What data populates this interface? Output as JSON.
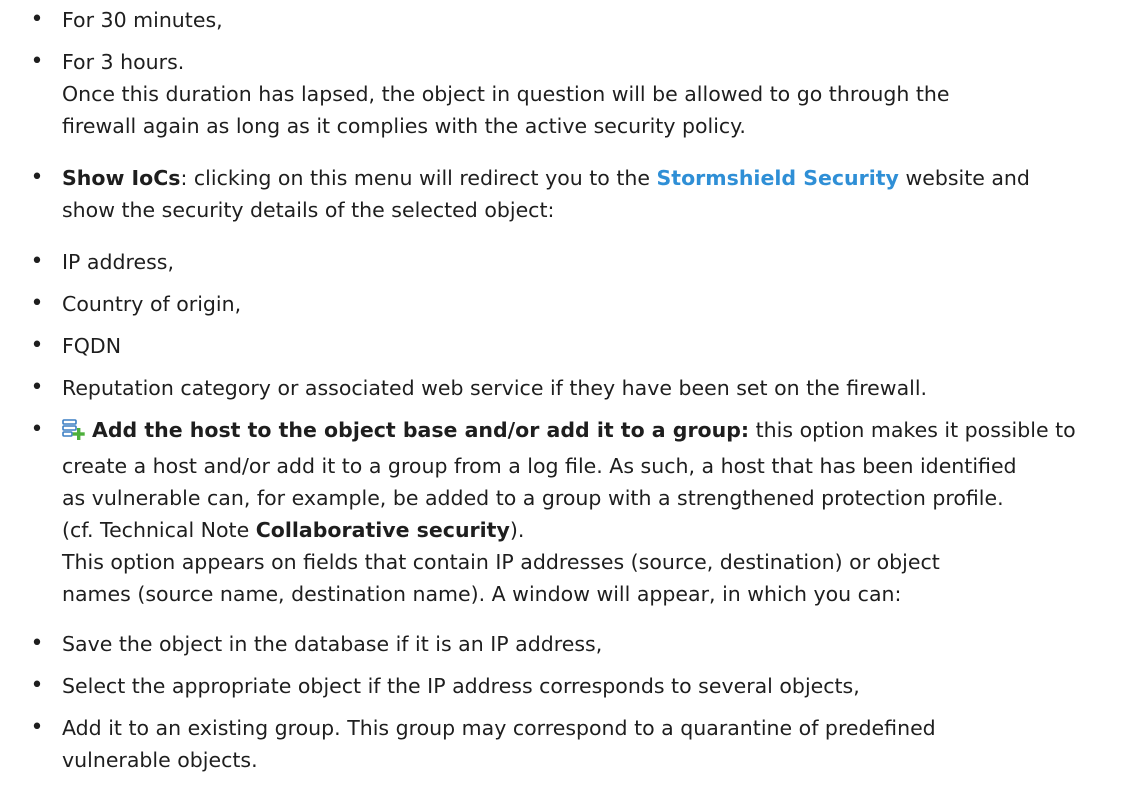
{
  "items": [
    {
      "text": "For 30 minutes,"
    },
    {
      "line1": "For 3 hours.",
      "line2": "Once this duration has lapsed, the object in question will be allowed to go through the",
      "line3": "firewall again as long as it complies with the active security policy."
    },
    {
      "term": "Show IoCs",
      "pre": ": clicking on this menu will redirect you to the ",
      "link": "Stormshield Security",
      "post": " website and",
      "line2": "show the security details of the selected object:"
    },
    {
      "text": "IP address,"
    },
    {
      "text": "Country of origin,"
    },
    {
      "text": "FQDN"
    },
    {
      "text": "Reputation category or associated web service if they have been set on the firewall."
    },
    {
      "icon": "add-host-icon",
      "term": "Add the host to the object base and/or add it to a group:",
      "post": " this option makes it possible to",
      "line2": "create a host and/or add it to a group from a log file. As such, a host that has been identified",
      "line3": "as vulnerable can, for example, be added to a group with a strengthened protection profile.",
      "line4_pre": "(cf. Technical Note ",
      "line4_term": "Collaborative security",
      "line4_post": ").",
      "line5": "This option appears on fields that contain IP addresses (source, destination) or object",
      "line6": "names (source name, destination name). A window will appear, in which you can:"
    },
    {
      "text": "Save the object in the database if it is an IP address,"
    },
    {
      "text": "Select the appropriate object if the IP address corresponds to several objects,"
    },
    {
      "line1": "Add it to an existing group. This group may correspond to a quarantine of predefined",
      "line2": "vulnerable objects."
    }
  ],
  "colors": {
    "text": "#1e1e1e",
    "link": "#2f8fd6",
    "icon_blue": "#3b7fc4",
    "icon_green": "#4caf3a"
  }
}
